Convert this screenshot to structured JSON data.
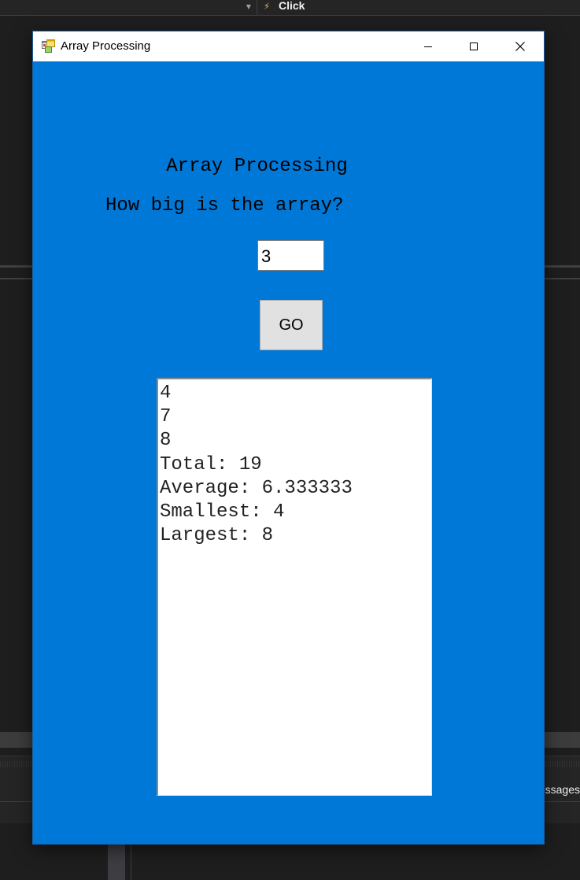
{
  "ide": {
    "event_label": "Click",
    "messages_tab_label": "Messages"
  },
  "window": {
    "title": "Array Processing",
    "heading": "Array Processing",
    "prompt": "How big is the array?",
    "size_input_value": "3",
    "go_button_label": "GO",
    "output_lines": [
      "4",
      "7",
      "8",
      "Total: 19",
      "Average: 6.333333",
      "Smallest: 4",
      "Largest: 8"
    ]
  },
  "colors": {
    "form_background": "#0078d7",
    "titlebar": "#ffffff",
    "ide_background": "#1e1e1e",
    "button_face": "#e1e1e1"
  },
  "icons": [
    "app-form-icon",
    "minimize-icon",
    "maximize-icon",
    "close-icon",
    "lightning-bolt-icon",
    "dropdown-arrow-icon"
  ]
}
